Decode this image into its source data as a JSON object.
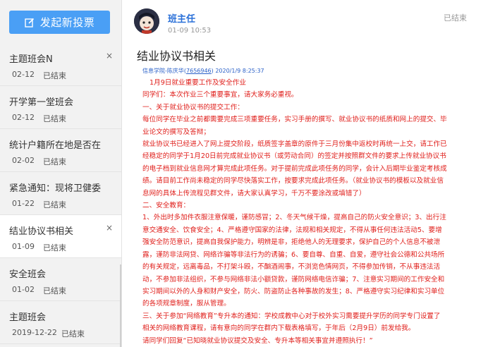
{
  "sidebar": {
    "new_vote_label": "发起新投票",
    "items": [
      {
        "title": "主题班会N",
        "date": "02-12",
        "status": "已结束",
        "close": "×"
      },
      {
        "title": "开学第一堂班会",
        "date": "02-12",
        "status": "已结束",
        "close": "×"
      },
      {
        "title": "统计户籍所在地是否在...",
        "date": "02-02",
        "status": "已结束",
        "close": "×"
      },
      {
        "title": "紧急通知：现将卫健委...",
        "date": "01-22",
        "status": "已结束",
        "close": "×"
      },
      {
        "title": "结业协议书相关",
        "date": "01-09",
        "status": "已结束",
        "close": "×"
      },
      {
        "title": "安全班会",
        "date": "01-02",
        "status": "已结束",
        "close": "×"
      },
      {
        "title": "主题班会",
        "date": "2019-12-22",
        "status": "已结束",
        "close": "×"
      }
    ]
  },
  "post": {
    "author": "班主任",
    "time": "01-09 10:53",
    "status": "已结束",
    "title": "结业协议书相关",
    "quote_sender": "信息学院-陈庆华(",
    "quote_qq": "7656946",
    "quote_time": ") 2020/1/9 8:25:37",
    "lines": [
      "1月9日就业重要工作及安全作业",
      "同学们：本次作业三个重要事宜，请大家务必重视。",
      "一、关于就业协议书的提交工作：",
      "每位同学在毕业之前都需要完成三项重要任务，实习手册的撰写、就业协议书的纸质和网上的提交、毕",
      "业论文的撰写及答辩；",
      "就业协议书已经进入了网上提交阶段，纸质签字盖章的原件于三月份集中返校时再统一上交，请工作已",
      "经稳定的同学于1月20日前完成就业协议书（或劳动合同）的签定并按照群文件的要求上传就业协议书",
      "的电子档到就业信息网才算完成此项任务。对于提前完成此项任务的同学，会计入后期毕业鉴定考核成",
      "绩。请目前工作尚未稳定的同学尽快落实工作，按要求完成此项任务。（就业协议书的模板以及就业信",
      "息网的具体上传流程见群文件，请大家认真学习，千万不要涂改或填错了）",
      "二、安全教育：",
      "1、外出时多加件衣服注意保暖，谨防感冒；2、冬天气候干燥，提高自己的防火安全意识；3、出行注",
      "意交通安全、饮食安全；4、严格遵守国家的法律，法规和相关规定，不得从事任何违法活动5、要增",
      "强安全防范意识，提高自我保护能力，明辨是非，拒绝他人的无理要求，保护自己的个人信息不被泄",
      "露，谨防非法网贷、网络诈骗等非法行为的诱骗；6、要自尊、自重、自爱，遵守社会公德和公共场所",
      "的有关规定，远离毒品，不打架斗殴，不酗酒闹事，不浏览色情网页，不得参加传销，不从事违法活",
      "动，不参加非法组织，不参与网络非法小额贷款，谨防网络电信诈骗；7、注意实习期间的工作安全和",
      "实习期间以外的人身和财产安全，防火、防盗防止各种事故的发生；8、严格遵守实习纪律和实习单位",
      "的各项规章制度，服从管理。",
      "三、关于参加“网络教育”专升本的通知：学校成教中心对于校外实习需要提升学历的同学专门设置了",
      "相关的网络教育课程，请有意向的同学在群内下载表格填写，于年后（2月9日）前发给我。",
      "请同学们回复“已知晓就业协议提交及安全、专升本等相关事宜并遵照执行！”"
    ]
  },
  "colors": {
    "accent": "#4a9ff5",
    "link": "#2a70d8",
    "message_red": "#e0201c"
  }
}
